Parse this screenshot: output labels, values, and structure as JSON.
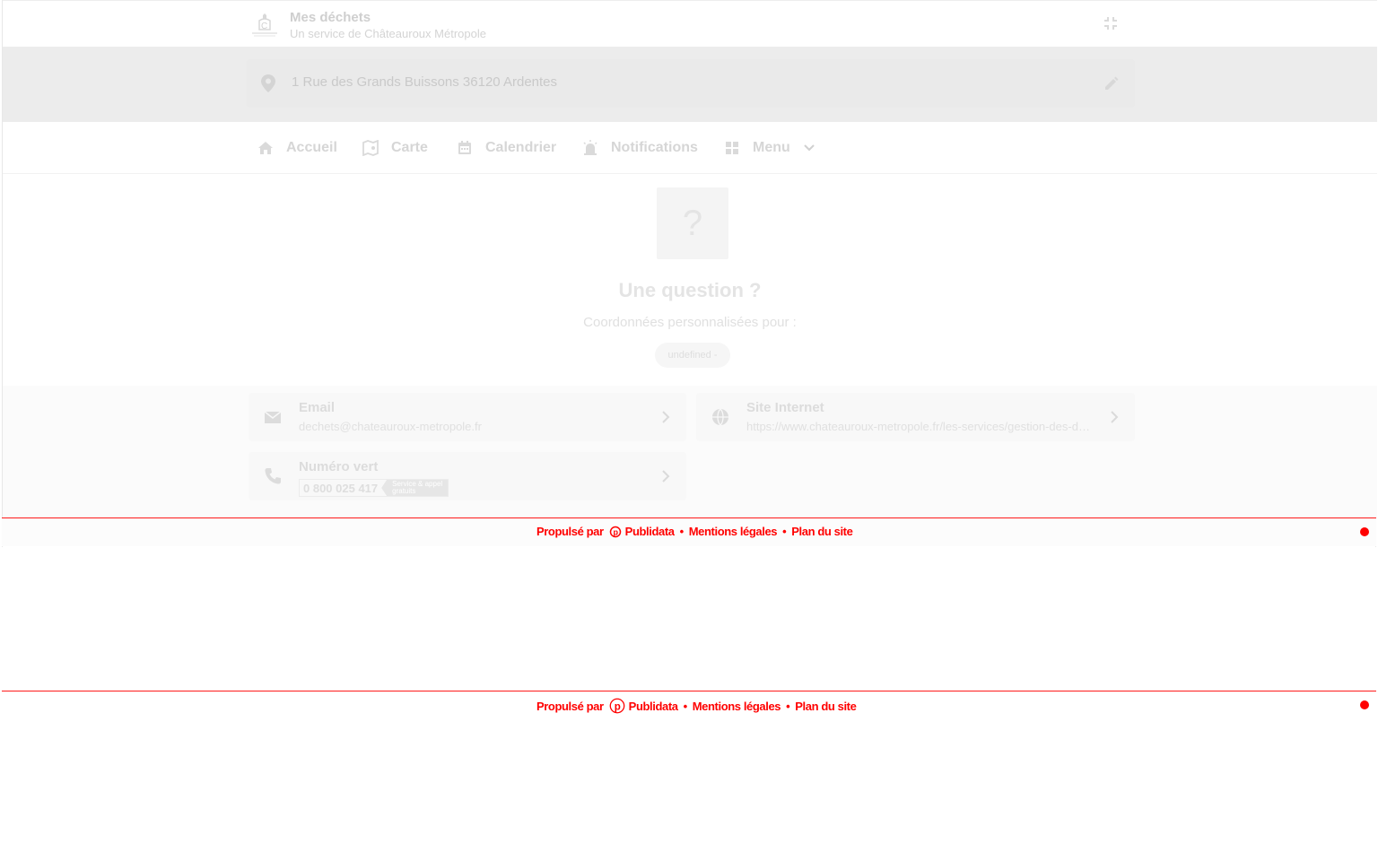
{
  "header": {
    "title": "Mes déchets",
    "subtitle": "Un service de Châteauroux Métropole"
  },
  "address": {
    "text": "1 Rue des Grands Buissons 36120 Ardentes"
  },
  "nav": {
    "items": [
      {
        "label": "Accueil",
        "icon": "home-icon"
      },
      {
        "label": "Carte",
        "icon": "map-icon"
      },
      {
        "label": "Calendrier",
        "icon": "calendar-icon"
      },
      {
        "label": "Notifications",
        "icon": "alarm-icon"
      },
      {
        "label": "Menu",
        "icon": "grid-icon"
      }
    ]
  },
  "question": {
    "symbol": "?",
    "title": "Une question ?",
    "subtitle": "Coordonnées personnalisées pour :",
    "chip": "undefined -"
  },
  "contacts": {
    "email": {
      "title": "Email",
      "value": "dechets@chateauroux-metropole.fr"
    },
    "website": {
      "title": "Site Internet",
      "value": "https://www.chateauroux-metropole.fr/les-services/gestion-des-dechets"
    },
    "phone": {
      "title": "Numéro vert",
      "number": "0 800 025 417",
      "tag_line1": "Service & appel",
      "tag_line2": "gratuits"
    }
  },
  "footer": {
    "powered_by": "Propulsé par",
    "brand": "Publidata",
    "separator": "•",
    "legal": "Mentions légales",
    "sitemap": "Plan du site"
  },
  "colors": {
    "accent": "#ff0000",
    "muted_text": "#d6d6d6",
    "band": "#ececec"
  }
}
